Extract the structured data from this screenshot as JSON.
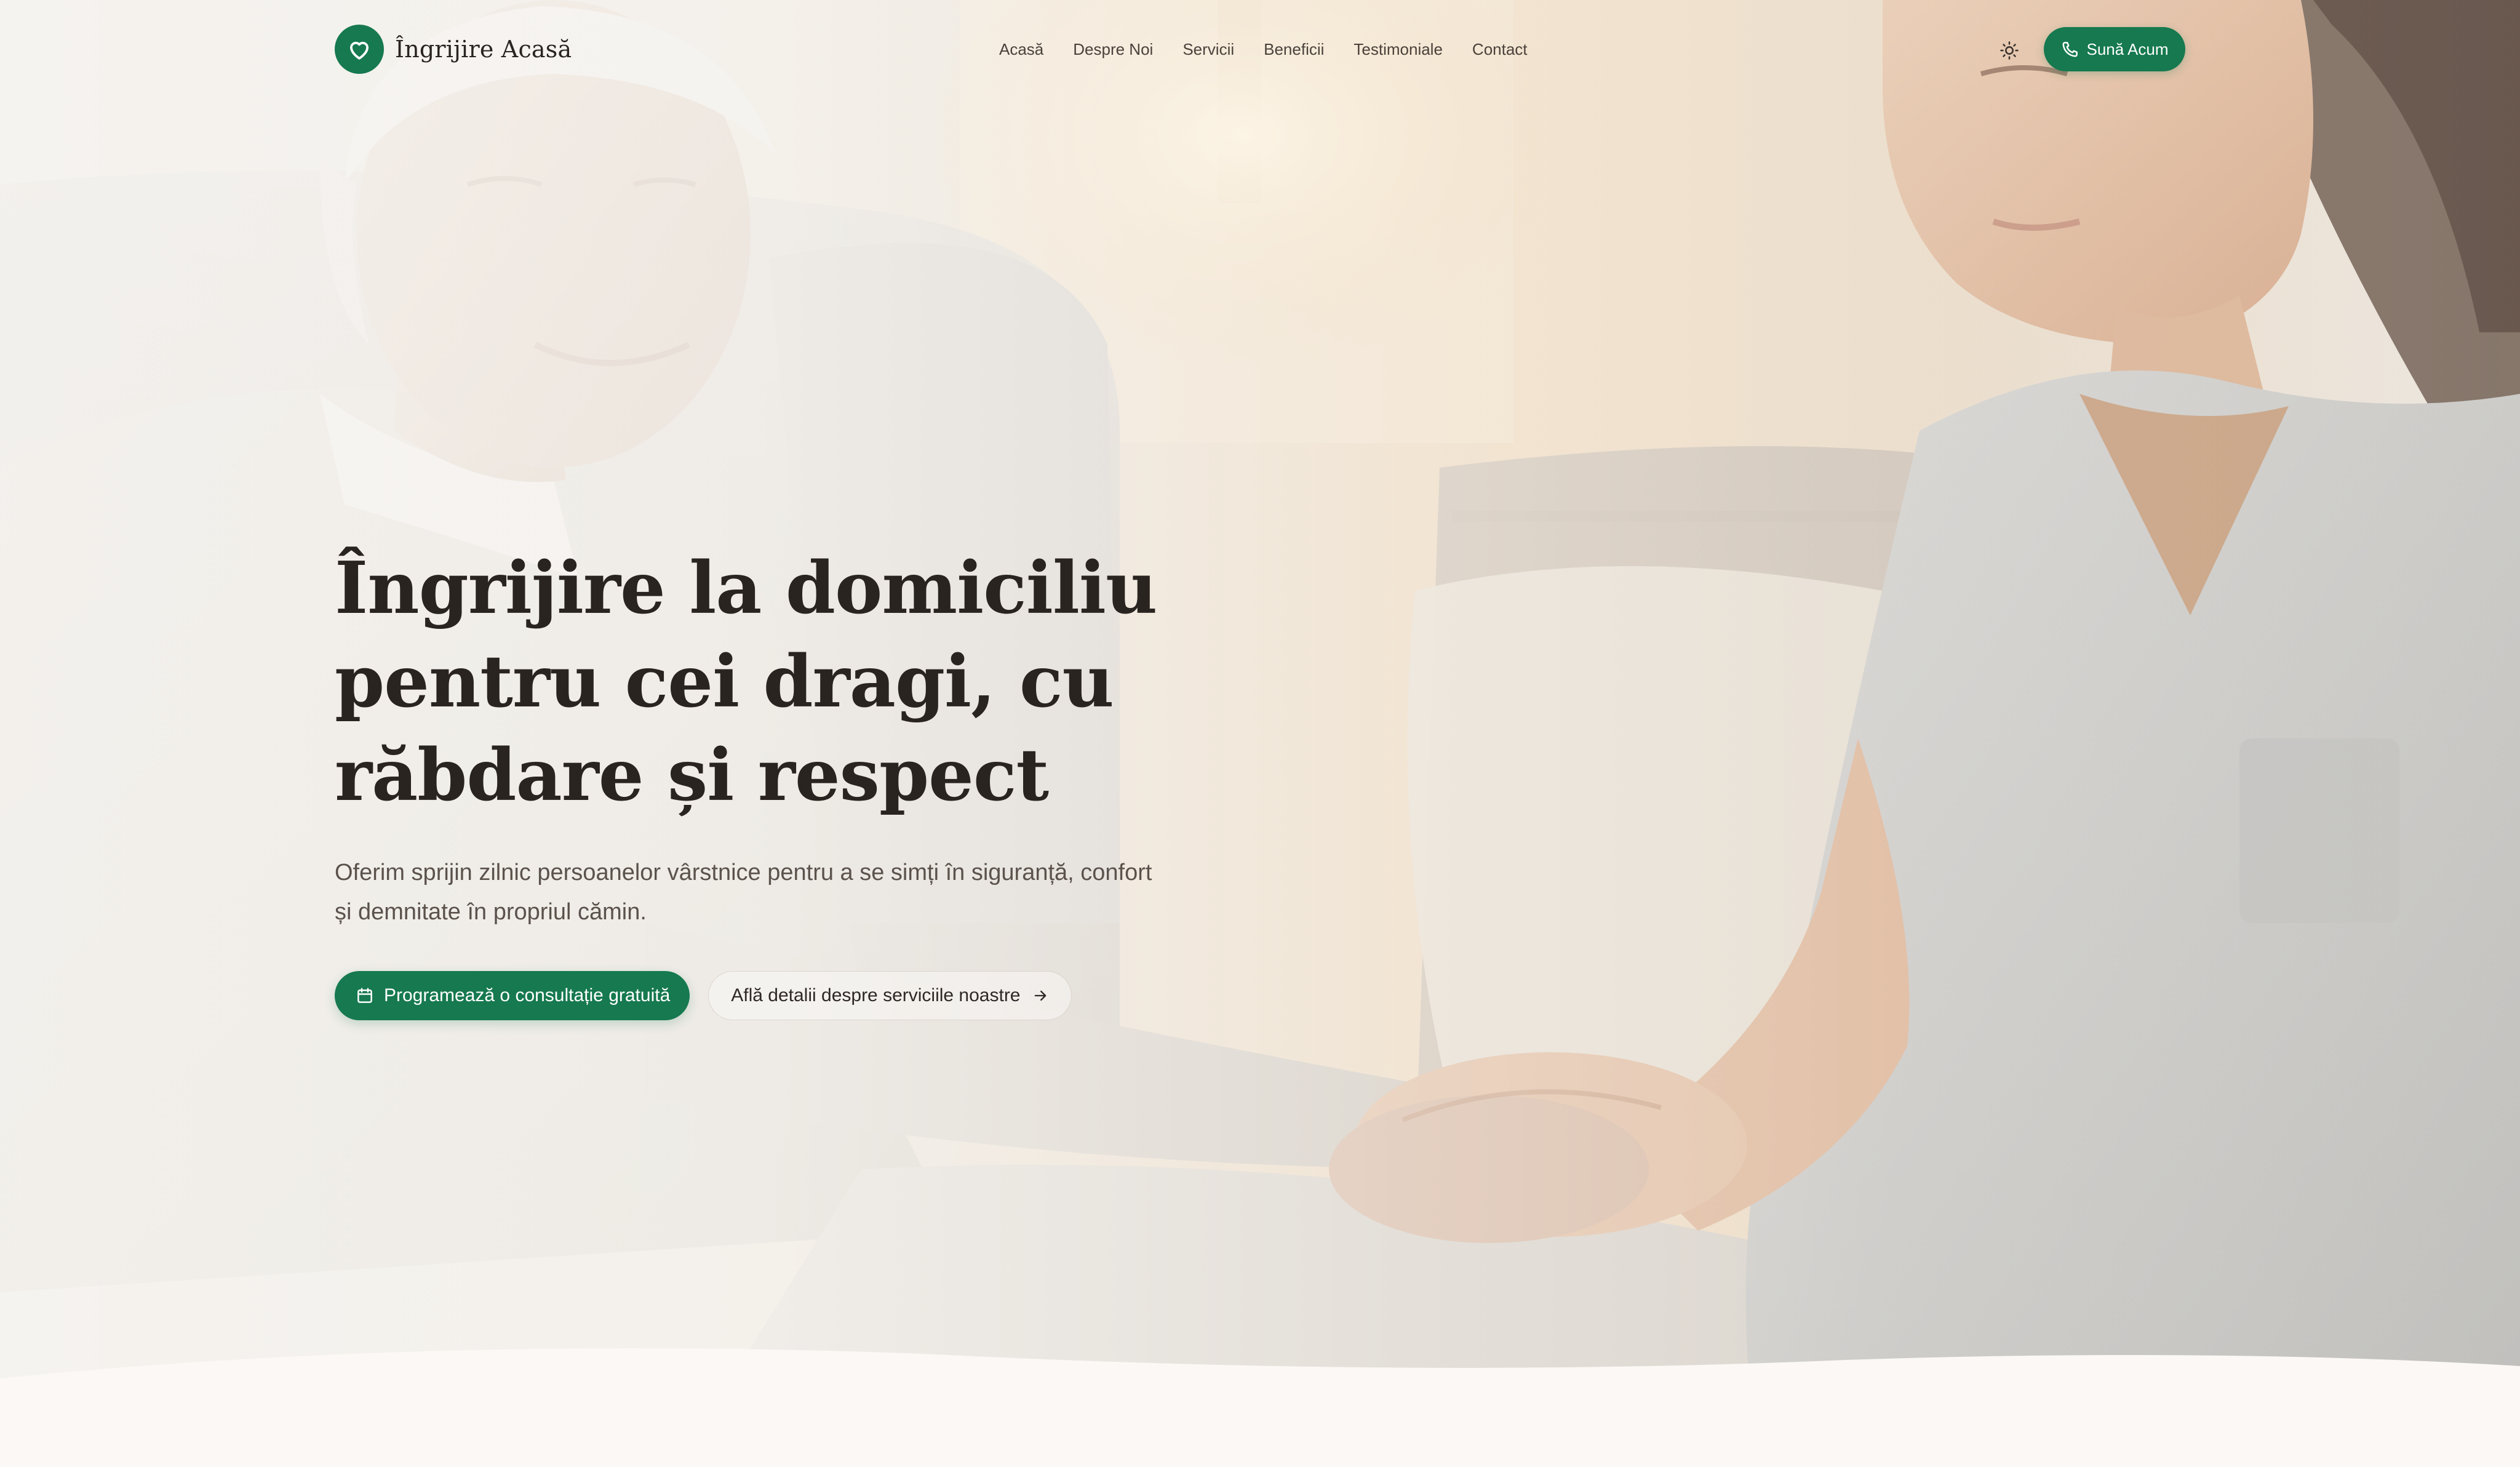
{
  "brand": {
    "name": "Îngrijire Acasă",
    "icon": "heart-icon",
    "color": "#16794f"
  },
  "nav": {
    "links": [
      "Acasă",
      "Despre Noi",
      "Servicii",
      "Beneficii",
      "Testimoniale",
      "Contact"
    ],
    "theme_toggle_icon": "sun-icon",
    "call_button": {
      "label": "Sună Acum",
      "icon": "phone-icon"
    }
  },
  "hero": {
    "title": "Îngrijire la domiciliu pentru cei dragi, cu răbdare și respect",
    "subtitle": "Oferim sprijin zilnic persoanelor vârstnice pentru a se simți în siguranță, confort și demnitate în propriul cămin.",
    "primary_cta": {
      "label": "Programează o consultație gratuită",
      "icon": "calendar-icon"
    },
    "secondary_cta": {
      "label": "Află detalii despre serviciile noastre",
      "icon": "arrow-right-icon"
    },
    "background": "elderly man seated on sofa, caregiver in light gray scrubs holding his hands"
  },
  "colors": {
    "accent": "#16794f",
    "text_dark": "#2a2420",
    "text_muted": "#5b524c",
    "page_bg": "#fbf8f5"
  }
}
